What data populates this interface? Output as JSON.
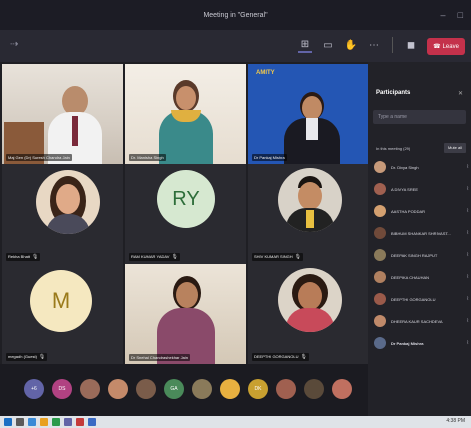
{
  "window": {
    "title": "Meeting in \"General\""
  },
  "toolbar": {
    "leave_label": "Leave"
  },
  "tiles": [
    {
      "name": "Maj Gen (Dr) Suresh Chandra Jain",
      "initials": ""
    },
    {
      "name": "Dr. Manisha Singh",
      "initials": ""
    },
    {
      "name": "Dr Pankaj Mishra",
      "initials": "",
      "logo": "AMITY"
    },
    {
      "name": "Rekha Bhatt",
      "initials": ""
    },
    {
      "name": "RAM KUMAR YADAV",
      "initials": "RY"
    },
    {
      "name": "SHIV KUMAR SINGH",
      "initials": ""
    },
    {
      "name": "megadh (Guest)",
      "initials": "M"
    },
    {
      "name": "Dr Snehal Chandrashekhar Jain",
      "initials": ""
    },
    {
      "name": "DEEPTHI GORGANOLU",
      "initials": ""
    }
  ],
  "dock": [
    {
      "label": "+6",
      "color": "#6264a7"
    },
    {
      "label": "DS",
      "color": "#b14282"
    },
    {
      "label": "",
      "color": "#9a6b5a"
    },
    {
      "label": "",
      "color": "#c48a6a"
    },
    {
      "label": "",
      "color": "#7a5c4a"
    },
    {
      "label": "GA",
      "color": "#4a8a5a"
    },
    {
      "label": "",
      "color": "#8a7a5a"
    },
    {
      "label": "",
      "color": "#e8b040"
    },
    {
      "label": "DK",
      "color": "#c8a030"
    },
    {
      "label": "",
      "color": "#a06050"
    },
    {
      "label": "",
      "color": "#5a4a3a"
    },
    {
      "label": "",
      "color": "#c07060"
    }
  ],
  "panel": {
    "title": "Participants",
    "search_placeholder": "Type a name",
    "in_meeting": "In this meeting (29)",
    "mute_all": "Mute all",
    "participants": [
      {
        "name": "Dr. Divya Singh",
        "color": "#c79a7a"
      },
      {
        "name": "A DIVYA SREE",
        "color": "#a06050"
      },
      {
        "name": "AASTHA PODDAR",
        "color": "#d4a070"
      },
      {
        "name": "BIBHUM SHANKAR SHRIVAST...",
        "color": "#704a3a"
      },
      {
        "name": "DEEPAK SINGH RAJPUT",
        "color": "#8a7a5a"
      },
      {
        "name": "DEEPIKA CHAUHAN",
        "color": "#b08060"
      },
      {
        "name": "DEEPTHI GORGANOLU",
        "color": "#9a5a4a"
      },
      {
        "name": "DHEERA KAUR SACHDEVA",
        "color": "#c08a6a"
      },
      {
        "name": "Dr Pankaj Mishra",
        "color": "#5a6a8a"
      }
    ]
  },
  "taskbar": {
    "clock": "4:38 PM"
  }
}
